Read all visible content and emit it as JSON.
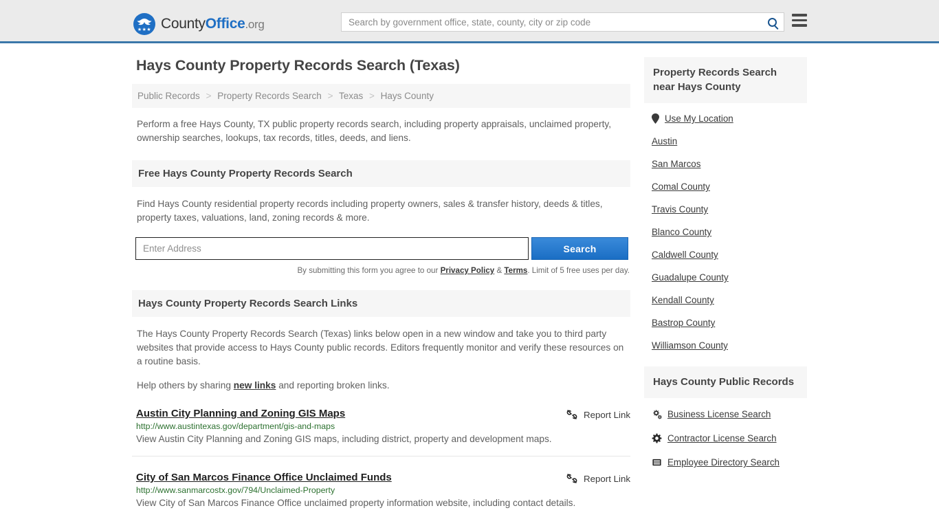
{
  "header": {
    "brand": {
      "part1": "County",
      "part2": "Office",
      "part3": ".org",
      "logo_icon": "eagle-seal-icon"
    },
    "search": {
      "placeholder": "Search by government office, state, county, city or zip code",
      "value": "",
      "icon": "search-icon"
    },
    "menu_icon": "hamburger-menu-icon"
  },
  "main": {
    "page_title": "Hays County Property Records Search (Texas)",
    "breadcrumb": [
      {
        "label": "Public Records"
      },
      {
        "label": "Property Records Search"
      },
      {
        "label": "Texas"
      },
      {
        "label": "Hays County"
      }
    ],
    "breadcrumb_separator": ">",
    "intro": "Perform a free Hays County, TX public property records search, including property appraisals, unclaimed property, ownership searches, lookups, tax records, titles, deeds, and liens.",
    "search_panel": {
      "heading": "Free Hays County Property Records Search",
      "description": "Find Hays County residential property records including property owners, sales & transfer history, deeds & titles, property taxes, valuations, land, zoning records & more.",
      "input_placeholder": "Enter Address",
      "input_value": "",
      "button_label": "Search",
      "note_prefix": "By submitting this form you agree to our ",
      "note_privacy": "Privacy Policy",
      "note_amp": " & ",
      "note_terms": "Terms",
      "note_suffix": ". Limit of 5 free uses per day."
    },
    "links_panel": {
      "heading": "Hays County Property Records Search Links",
      "description": "The Hays County Property Records Search (Texas) links below open in a new window and take you to third party websites that provide access to Hays County public records. Editors frequently monitor and verify these resources on a routine basis.",
      "help_prefix": "Help others by sharing ",
      "help_link": "new links",
      "help_suffix": " and reporting broken links.",
      "report_label": "Report Link",
      "report_icon": "unlink-icon",
      "results": [
        {
          "title": "Austin City Planning and Zoning GIS Maps",
          "url": "http://www.austintexas.gov/department/gis-and-maps",
          "description": "View Austin City Planning and Zoning GIS maps, including district, property and development maps."
        },
        {
          "title": "City of San Marcos Finance Office Unclaimed Funds",
          "url": "http://www.sanmarcostx.gov/794/Unclaimed-Property",
          "description": "View City of San Marcos Finance Office unclaimed property information website, including contact details."
        }
      ]
    }
  },
  "sidebar": {
    "nearby_panel": {
      "heading": "Property Records Search near Hays County",
      "items": [
        {
          "label": "Use My Location",
          "icon": "map-pin-icon"
        },
        {
          "label": "Austin",
          "icon": null
        },
        {
          "label": "San Marcos",
          "icon": null
        },
        {
          "label": "Comal County",
          "icon": null
        },
        {
          "label": "Travis County",
          "icon": null
        },
        {
          "label": "Blanco County",
          "icon": null
        },
        {
          "label": "Caldwell County",
          "icon": null
        },
        {
          "label": "Guadalupe County",
          "icon": null
        },
        {
          "label": "Kendall County",
          "icon": null
        },
        {
          "label": "Bastrop County",
          "icon": null
        },
        {
          "label": "Williamson County",
          "icon": null
        }
      ]
    },
    "records_panel": {
      "heading": "Hays County Public Records",
      "items": [
        {
          "label": "Business License Search",
          "icon": "cogs-icon"
        },
        {
          "label": "Contractor License Search",
          "icon": "gear-icon"
        },
        {
          "label": "Employee Directory Search",
          "icon": "list-icon"
        }
      ]
    }
  },
  "colors": {
    "brand_blue": "#1f6fc4",
    "header_bg": "#ebebeb",
    "header_border": "#3b77a9",
    "panel_bg": "#f6f6f6",
    "url_green": "#2d7130",
    "button_blue": "#1a6ec4"
  }
}
